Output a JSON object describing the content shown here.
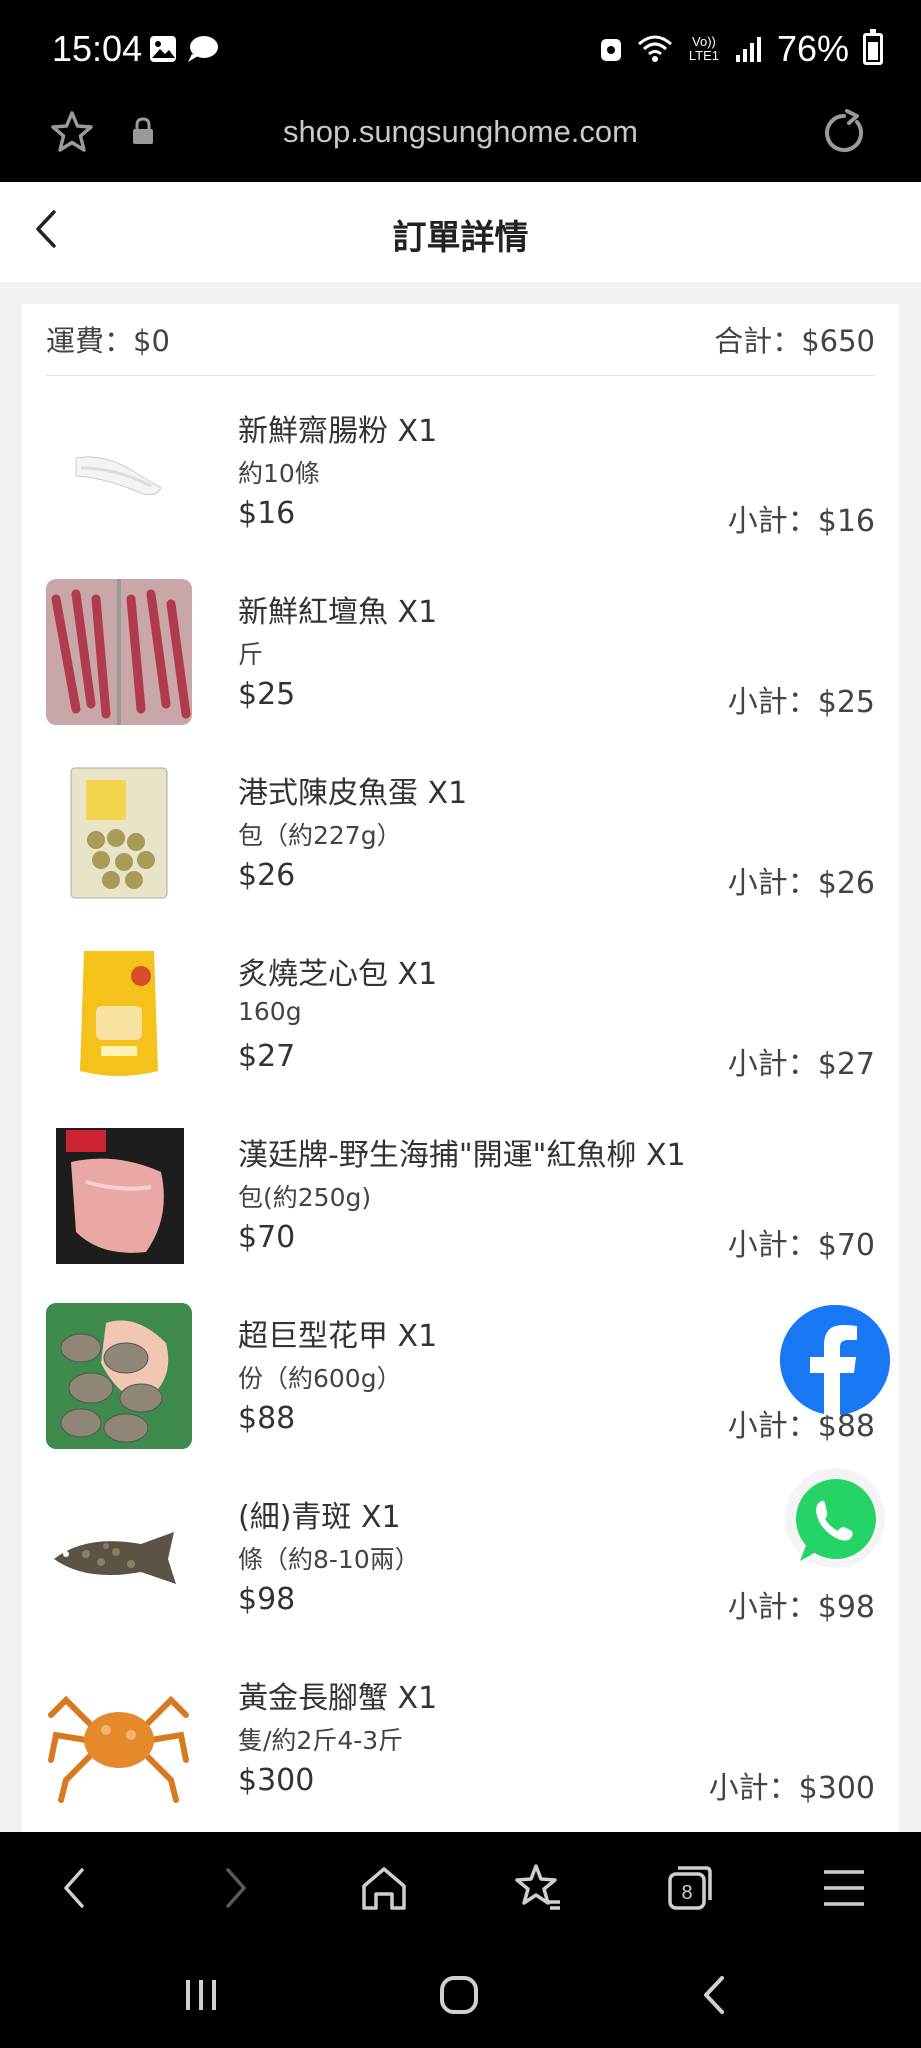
{
  "status": {
    "time": "15:04",
    "battery": "76%",
    "network": "Vo)) LTE1"
  },
  "browser": {
    "url": "shop.sungsunghome.com"
  },
  "header": {
    "title": "訂單詳情"
  },
  "summary": {
    "shipping": "運費：$0",
    "total": "合計：$650"
  },
  "items": [
    {
      "name": "新鮮齋腸粉 X1",
      "unit": "約10條",
      "price": "$16",
      "subtotal": "小計：$16"
    },
    {
      "name": "新鮮紅壇魚 X1",
      "unit": "斤",
      "price": "$25",
      "subtotal": "小計：$25"
    },
    {
      "name": "港式陳皮魚蛋 X1",
      "unit": "包（約227g）",
      "price": "$26",
      "subtotal": "小計：$26"
    },
    {
      "name": "炙燒芝心包 X1",
      "unit": "160g",
      "price": "$27",
      "subtotal": "小計：$27"
    },
    {
      "name": "漢廷牌-野生海捕\"開運\"紅魚柳 X1",
      "unit": "包(約250g)",
      "price": "$70",
      "subtotal": "小計：$70"
    },
    {
      "name": "超巨型花甲 X1",
      "unit": "份（約600g）",
      "price": "$88",
      "subtotal": "小計：$88"
    },
    {
      "name": "(細)青斑 X1",
      "unit": "條（約8-10兩）",
      "price": "$98",
      "subtotal": "小計：$98"
    },
    {
      "name": "黃金長腳蟹 X1",
      "unit": "隻/約2斤4-3斤",
      "price": "$300",
      "subtotal": "小計：$300"
    }
  ],
  "colors": {
    "facebook": "#1877f2",
    "whatsapp": "#25d366"
  }
}
